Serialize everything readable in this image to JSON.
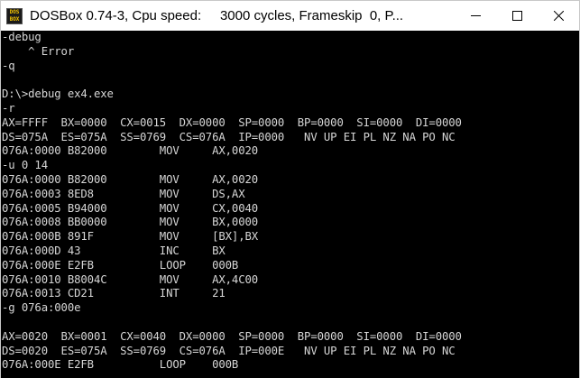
{
  "window": {
    "icon_glyphs": [
      "DOS",
      "BOX"
    ],
    "title": "DOSBox 0.74-3, Cpu speed:     3000 cycles, Frameskip  0, P..."
  },
  "caption_buttons": {
    "minimize_icon": "minimize-icon",
    "maximize_icon": "maximize-icon",
    "close_icon": "close-icon"
  },
  "console": {
    "lines": [
      "-debug",
      "    ^ Error",
      "-q",
      "",
      "D:\\>debug ex4.exe",
      "-r",
      "AX=FFFF  BX=0000  CX=0015  DX=0000  SP=0000  BP=0000  SI=0000  DI=0000",
      "DS=075A  ES=075A  SS=0769  CS=076A  IP=0000   NV UP EI PL NZ NA PO NC",
      "076A:0000 B82000        MOV     AX,0020",
      "-u 0 14",
      "076A:0000 B82000        MOV     AX,0020",
      "076A:0003 8ED8          MOV     DS,AX",
      "076A:0005 B94000        MOV     CX,0040",
      "076A:0008 BB0000        MOV     BX,0000",
      "076A:000B 891F          MOV     [BX],BX",
      "076A:000D 43            INC     BX",
      "076A:000E E2FB          LOOP    000B",
      "076A:0010 B8004C        MOV     AX,4C00",
      "076A:0013 CD21          INT     21",
      "-g 076a:000e",
      "",
      "AX=0020  BX=0001  CX=0040  DX=0000  SP=0000  BP=0000  SI=0000  DI=0000",
      "DS=0020  ES=075A  SS=0769  CS=076A  IP=000E   NV UP EI PL NZ NA PO NC",
      "076A:000E E2FB          LOOP    000B"
    ]
  },
  "colors": {
    "titlebar_bg": "#ffffff",
    "console_bg": "#000000",
    "console_text": "#d6d6d6"
  }
}
